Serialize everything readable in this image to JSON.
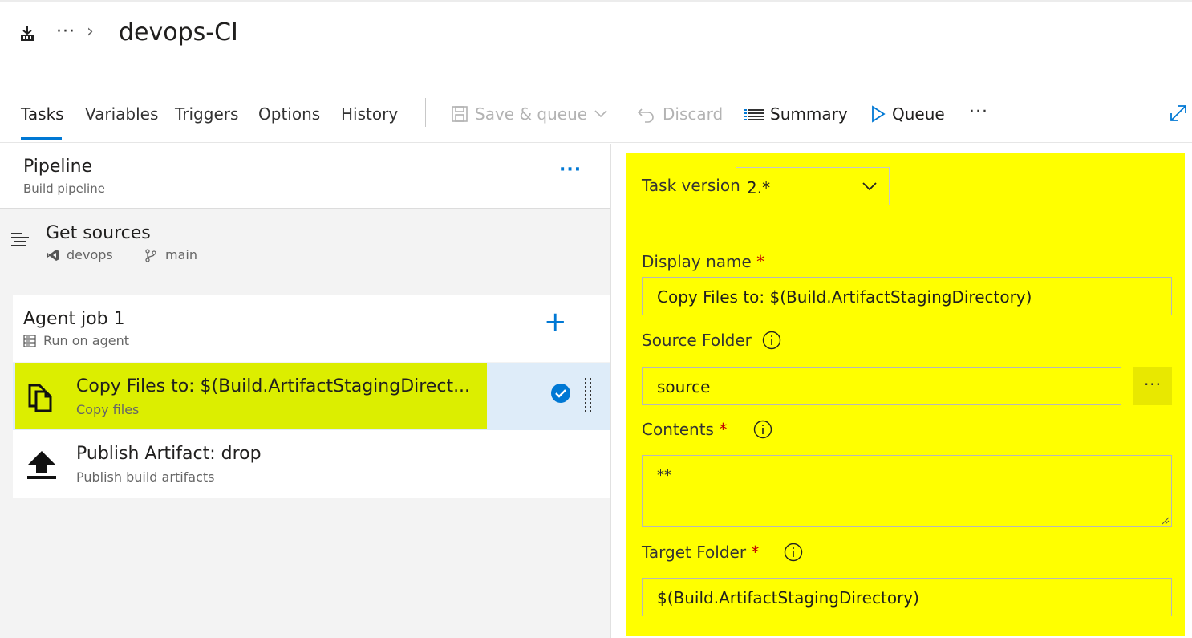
{
  "header": {
    "breadcrumb_more": "···",
    "breadcrumb_chevron": "›",
    "title": "devops-CI"
  },
  "tabs": [
    {
      "label": "Tasks",
      "active": true
    },
    {
      "label": "Variables",
      "active": false
    },
    {
      "label": "Triggers",
      "active": false
    },
    {
      "label": "Options",
      "active": false
    },
    {
      "label": "History",
      "active": false
    }
  ],
  "toolbar": {
    "save_queue_label": "Save & queue",
    "discard_label": "Discard",
    "summary_label": "Summary",
    "queue_label": "Queue",
    "more_label": "···"
  },
  "pipeline": {
    "title": "Pipeline",
    "subtitle": "Build pipeline",
    "more_label": "···"
  },
  "sources": {
    "title": "Get sources",
    "repo": "devops",
    "branch": "main"
  },
  "agent_job": {
    "title": "Agent job 1",
    "subtitle": "Run on agent",
    "add_label": "+"
  },
  "tasks": [
    {
      "title": "Copy Files to: $(Build.ArtifactStagingDirect...",
      "subtitle": "Copy files",
      "selected": true,
      "icon": "copy-files-icon"
    },
    {
      "title": "Publish Artifact: drop",
      "subtitle": "Publish build artifacts",
      "selected": false,
      "icon": "upload-icon"
    }
  ],
  "details": {
    "task_version_label": "Task version",
    "task_version_value": "2.*",
    "display_name_label": "Display name",
    "display_name_value": "Copy Files to: $(Build.ArtifactStagingDirectory)",
    "source_folder_label": "Source Folder",
    "source_folder_value": "source",
    "browse_label": "···",
    "contents_label": "Contents",
    "contents_value": "**",
    "target_folder_label": "Target Folder",
    "target_folder_value": "$(Build.ArtifactStagingDirectory)",
    "required_marker": "*"
  },
  "colors": {
    "accent": "#0078d4",
    "highlight_panel": "#ffff00",
    "highlight_task": "#dcee00",
    "selected_row": "#deecf9"
  }
}
